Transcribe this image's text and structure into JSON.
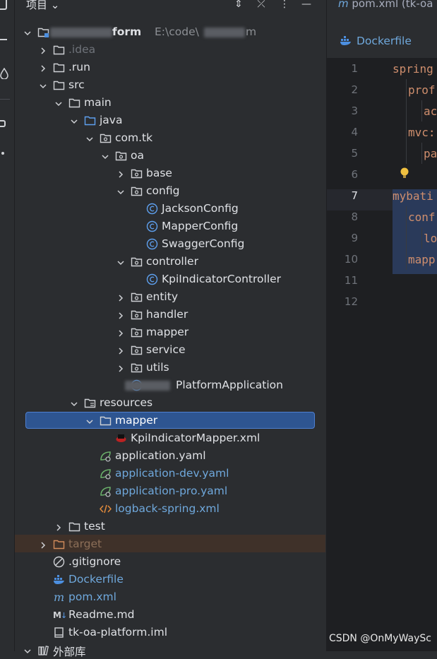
{
  "project_panel": {
    "title": "项目",
    "collapse_glyph": "⌄",
    "header_icons": [
      "⇕",
      "⤫",
      "⋮",
      "—"
    ]
  },
  "tree": [
    {
      "level": 0,
      "arrow": "open",
      "icon": "module",
      "label": "form",
      "extra": "E:\\code\\",
      "extra2": "m",
      "color": "#dfe1e5"
    },
    {
      "level": 1,
      "arrow": "closed",
      "icon": "folder",
      "label": ".idea",
      "color": "#6f737a"
    },
    {
      "level": 1,
      "arrow": "closed",
      "icon": "folder",
      "label": ".run",
      "color": "#dfe1e5"
    },
    {
      "level": 1,
      "arrow": "open",
      "icon": "folder",
      "label": "src",
      "color": "#dfe1e5"
    },
    {
      "level": 2,
      "arrow": "open",
      "icon": "folder",
      "label": "main",
      "color": "#dfe1e5"
    },
    {
      "level": 3,
      "arrow": "open",
      "icon": "source-folder",
      "label": "java",
      "color": "#dfe1e5"
    },
    {
      "level": 4,
      "arrow": "open",
      "icon": "package",
      "label": "com.tk",
      "color": "#dfe1e5"
    },
    {
      "level": 5,
      "arrow": "open",
      "icon": "package",
      "label": "oa",
      "color": "#dfe1e5"
    },
    {
      "level": 6,
      "arrow": "closed",
      "icon": "package",
      "label": "base",
      "color": "#dfe1e5"
    },
    {
      "level": 6,
      "arrow": "open",
      "icon": "package",
      "label": "config",
      "color": "#dfe1e5"
    },
    {
      "level": 7,
      "arrow": "none",
      "icon": "class",
      "label": "JacksonConfig",
      "color": "#dfe1e5"
    },
    {
      "level": 7,
      "arrow": "none",
      "icon": "class",
      "label": "MapperConfig",
      "color": "#dfe1e5"
    },
    {
      "level": 7,
      "arrow": "none",
      "icon": "class",
      "label": "SwaggerConfig",
      "color": "#dfe1e5"
    },
    {
      "level": 6,
      "arrow": "open",
      "icon": "package",
      "label": "controller",
      "color": "#dfe1e5"
    },
    {
      "level": 7,
      "arrow": "none",
      "icon": "class",
      "label": "KpiIndicatorController",
      "color": "#dfe1e5"
    },
    {
      "level": 6,
      "arrow": "closed",
      "icon": "package",
      "label": "entity",
      "color": "#dfe1e5"
    },
    {
      "level": 6,
      "arrow": "closed",
      "icon": "package",
      "label": "handler",
      "color": "#dfe1e5"
    },
    {
      "level": 6,
      "arrow": "closed",
      "icon": "package",
      "label": "mapper",
      "color": "#dfe1e5"
    },
    {
      "level": 6,
      "arrow": "closed",
      "icon": "package",
      "label": "service",
      "color": "#dfe1e5"
    },
    {
      "level": 6,
      "arrow": "closed",
      "icon": "package",
      "label": "utils",
      "color": "#dfe1e5"
    },
    {
      "level": 6,
      "arrow": "none",
      "icon": "spring-class",
      "label": "PlatformApplication",
      "color": "#dfe1e5",
      "blurred_prefix": true
    },
    {
      "level": 3,
      "arrow": "open",
      "icon": "resources-folder",
      "label": "resources",
      "color": "#dfe1e5"
    },
    {
      "level": 4,
      "arrow": "open",
      "icon": "folder",
      "label": "mapper",
      "color": "#ffffff",
      "selected": true
    },
    {
      "level": 5,
      "arrow": "none",
      "icon": "mybatis",
      "label": "KpiIndicatorMapper.xml",
      "color": "#dfe1e5"
    },
    {
      "level": 4,
      "arrow": "none",
      "icon": "spring-yaml",
      "label": "application.yaml",
      "color": "#dfe1e5"
    },
    {
      "level": 4,
      "arrow": "none",
      "icon": "spring-yaml",
      "label": "application-dev.yaml",
      "color": "#6fa8dc"
    },
    {
      "level": 4,
      "arrow": "none",
      "icon": "spring-yaml",
      "label": "application-pro.yaml",
      "color": "#6fa8dc"
    },
    {
      "level": 4,
      "arrow": "none",
      "icon": "xml",
      "label": "logback-spring.xml",
      "color": "#6fa8dc"
    },
    {
      "level": 2,
      "arrow": "closed",
      "icon": "folder",
      "label": "test",
      "color": "#dfe1e5"
    },
    {
      "level": 1,
      "arrow": "closed",
      "icon": "excluded-folder",
      "label": "target",
      "color": "#8c6f58"
    },
    {
      "level": 1,
      "arrow": "none",
      "icon": "ignore",
      "label": ".gitignore",
      "color": "#dfe1e5"
    },
    {
      "level": 1,
      "arrow": "none",
      "icon": "docker",
      "label": "Dockerfile",
      "color": "#6fa8dc"
    },
    {
      "level": 1,
      "arrow": "none",
      "icon": "maven",
      "label": "pom.xml",
      "color": "#6fa8dc"
    },
    {
      "level": 1,
      "arrow": "none",
      "icon": "markdown",
      "label": "Readme.md",
      "color": "#dfe1e5"
    },
    {
      "level": 1,
      "arrow": "none",
      "icon": "iml",
      "label": "tk-oa-platform.iml",
      "color": "#dfe1e5"
    },
    {
      "level": 0,
      "arrow": "open",
      "icon": "libraries",
      "label": "外部库",
      "color": "#dfe1e5"
    }
  ],
  "editor": {
    "tab_pom": "pom.xml (tk-oa",
    "tab_docker": "Dockerfile",
    "line_numbers": [
      "1",
      "2",
      "3",
      "4",
      "5",
      "6",
      "7",
      "8",
      "9",
      "10",
      "11",
      "12"
    ],
    "code_lines": [
      {
        "text": "spring",
        "color": "#cf8e6d",
        "indent": 0
      },
      {
        "text": "prof",
        "color": "#cf8e6d",
        "indent": 1
      },
      {
        "text": "ac",
        "color": "#cf8e6d",
        "indent": 2
      },
      {
        "text": "mvc:",
        "color": "#cf8e6d",
        "indent": 1
      },
      {
        "text": "pa",
        "color": "#cf8e6d",
        "indent": 2
      },
      {
        "text": "",
        "color": "#cf8e6d",
        "indent": 0
      },
      {
        "text": "mybati",
        "color": "#cf8e6d",
        "indent": 0
      },
      {
        "text": "conf",
        "color": "#cf8e6d",
        "indent": 1
      },
      {
        "text": "lo",
        "color": "#cf8e6d",
        "indent": 2
      },
      {
        "text": "mapp",
        "color": "#cf8e6d",
        "indent": 1
      },
      {
        "text": "",
        "color": "#cf8e6d",
        "indent": 0
      },
      {
        "text": "",
        "color": "#cf8e6d",
        "indent": 0
      }
    ]
  },
  "watermark": "CSDN @OnMyWaySc"
}
